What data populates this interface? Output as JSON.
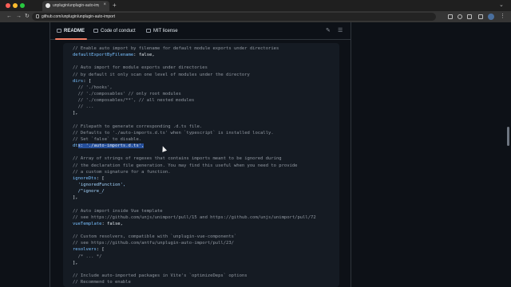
{
  "browser": {
    "tab_title": "unplugin/unplugin-auto-impo",
    "tab_close": "×",
    "new_tab": "+",
    "tab_list": "⌄",
    "url": "github.com/unplugin/unplugin-auto-import",
    "nav": {
      "back": "←",
      "forward": "→",
      "reload": "↻"
    },
    "menu": "⋮"
  },
  "readme_tabs": [
    {
      "label": "README"
    },
    {
      "label": "Code of conduct"
    },
    {
      "label": "MIT license"
    }
  ],
  "icons": {
    "edit": "✎",
    "toc": "☰"
  },
  "code_lines": [
    "// Enable auto import by filename for default module exports under directories",
    "defaultExportByFilename: false,",
    "",
    "// Auto import for module exports under directories",
    "// by default it only scan one level of modules under the directory",
    "dirs: [",
    "  // './hooks',",
    "  // './composables' // only root modules",
    "  // './composables/**', // all nested modules",
    "  // ...",
    "],",
    "",
    "// Filepath to generate corresponding .d.ts file.",
    "// Defaults to './auto-imports.d.ts' when `typescript` is installed locally.",
    "// Set `false` to disable.",
    "dts: './auto-imports.d.ts',",
    "",
    "// Array of strings of regexes that contains imports meant to be ignored during",
    "// the declaration file generation. You may find this useful when you need to provide",
    "// a custom signature for a function.",
    "ignoreDts: [",
    "  'ignoredFunction',",
    "  /^ignore_/",
    "],",
    "",
    "// Auto import inside Vue template",
    "// see https://github.com/unjs/unimport/pull/15 and https://github.com/unjs/unimport/pull/72",
    "vueTemplate: false,",
    "",
    "// Custom resolvers, compatible with `unplugin-vue-components`",
    "// see https://github.com/antfu/unplugin-auto-import/pull/23/",
    "resolvers: [",
    "  /* ... */",
    "],",
    "",
    "// Include auto-imported packages in Vite's `optimizeDeps` options",
    "// Recommend to enable"
  ],
  "selected_text": "s: './auto-imports.d.ts',"
}
